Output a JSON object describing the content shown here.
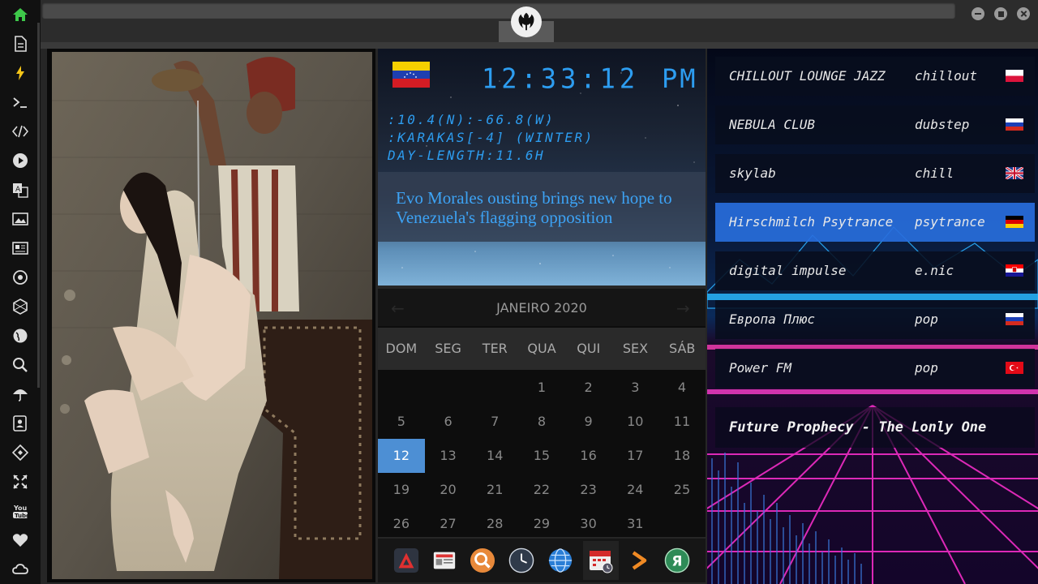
{
  "sidebar": {
    "icons": [
      "home-icon",
      "document-icon",
      "bolt-icon",
      "terminal-icon",
      "code-icon",
      "play-icon",
      "translate-icon",
      "image-icon",
      "newspaper-icon",
      "settings-icon",
      "hexagon-icon",
      "globe-icon",
      "search-icon",
      "umbrella-icon",
      "contacts-icon",
      "plugin-icon",
      "expand-icon",
      "youtube-icon",
      "heart-icon",
      "cloud-icon"
    ]
  },
  "titlebar": {
    "logo": "rebel-alliance-icon",
    "buttons": [
      "minimize-icon",
      "maximize-icon",
      "close-icon"
    ]
  },
  "clock": {
    "time": "12:33:12",
    "ampm": "PM",
    "coords": ":10.4(N):-66.8(W)",
    "city": ":KARAKAS[-4] (WINTER)",
    "day_length": "DAY-LENGTH:11.6H",
    "flag": "venezuela-flag"
  },
  "news": {
    "headline": "Evo Morales ousting brings new hope to Venezuela's flagging opposition"
  },
  "calendar": {
    "title": "JANEIRO 2020",
    "weekdays": [
      "DOM",
      "SEG",
      "TER",
      "QUA",
      "QUI",
      "SEX",
      "SÁB"
    ],
    "weeks": [
      [
        "",
        "",
        "",
        "1",
        "2",
        "3",
        "4"
      ],
      [
        "5",
        "6",
        "7",
        "8",
        "9",
        "10",
        "11"
      ],
      [
        "12",
        "13",
        "14",
        "15",
        "16",
        "17",
        "18"
      ],
      [
        "19",
        "20",
        "21",
        "22",
        "23",
        "24",
        "25"
      ],
      [
        "26",
        "27",
        "28",
        "29",
        "30",
        "31",
        ""
      ]
    ],
    "today": "12"
  },
  "dock": {
    "items": [
      "app-launcher-icon",
      "news-app-icon",
      "search-app-icon",
      "clock-app-icon",
      "browser-globe-icon",
      "calendar-app-icon",
      "play-arrow-icon",
      "yandex-icon"
    ]
  },
  "radio": {
    "stations": [
      {
        "name": "CHILLOUT LOUNGE JAZZ",
        "genre": "chillout",
        "flag": "poland-flag"
      },
      {
        "name": "NEBULA CLUB",
        "genre": "dubstep",
        "flag": "russia-flag"
      },
      {
        "name": "skylab",
        "genre": "chill",
        "flag": "uk-flag"
      },
      {
        "name": "Hirschmilch Psytrance",
        "genre": "psytrance",
        "flag": "germany-flag"
      },
      {
        "name": "digital impulse",
        "genre": "e.nic",
        "flag": "croatia-flag"
      },
      {
        "name": "Европа Плюс",
        "genre": "pop",
        "flag": "russia-flag"
      },
      {
        "name": "Power FM",
        "genre": "pop",
        "flag": "turkey-flag"
      }
    ],
    "active_index": 3,
    "now_playing": "Future Prophecy - The Lonly One"
  },
  "colors": {
    "accent_green": "#3ec84a",
    "clock_blue": "#2d9df0",
    "today_blue": "#4d8fd4",
    "active_station": "#2a6edc"
  }
}
